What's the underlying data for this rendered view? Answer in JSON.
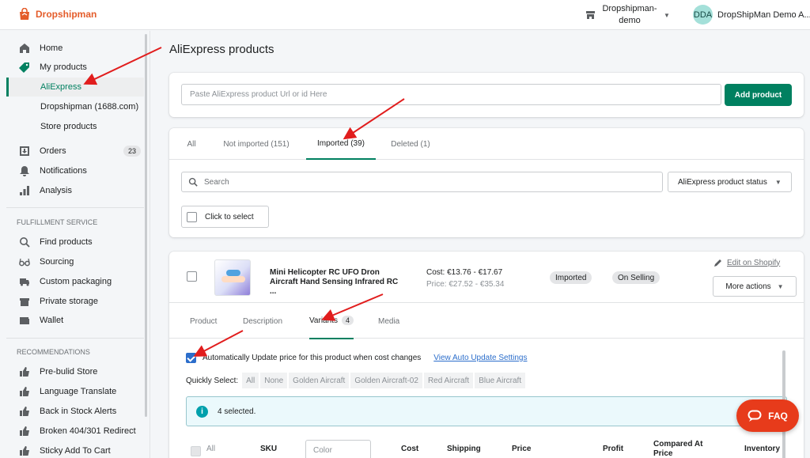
{
  "topbar": {
    "logo_text": "Dropshipman",
    "store_name": "Dropshipman-demo",
    "user_initials": "DDA",
    "user_name": "DropShipMan Demo A..."
  },
  "sidebar": {
    "items": [
      {
        "label": "Home",
        "icon": "home-icon"
      },
      {
        "label": "My products",
        "icon": "tag-icon"
      },
      {
        "label": "AliExpress",
        "active": true
      },
      {
        "label": "Dropshipman (1688.com)"
      },
      {
        "label": "Store products"
      },
      {
        "label": "Orders",
        "icon": "orders-icon",
        "count": "23"
      },
      {
        "label": "Notifications",
        "icon": "bell-icon"
      },
      {
        "label": "Analysis",
        "icon": "chart-icon"
      }
    ],
    "fulfillment_title": "FULFILLMENT SERVICE",
    "fulfillment": [
      {
        "label": "Find products",
        "icon": "search-icon"
      },
      {
        "label": "Sourcing",
        "icon": "glasses-icon"
      },
      {
        "label": "Custom packaging",
        "icon": "truck-icon"
      },
      {
        "label": "Private storage",
        "icon": "box-icon"
      },
      {
        "label": "Wallet",
        "icon": "wallet-icon"
      }
    ],
    "recommendations_title": "RECOMMENDATIONS",
    "recommendations": [
      {
        "label": "Pre-bulid Store",
        "icon": "thumbs-up-icon"
      },
      {
        "label": "Language Translate",
        "icon": "thumbs-up-icon"
      },
      {
        "label": "Back in Stock Alerts",
        "icon": "thumbs-up-icon"
      },
      {
        "label": "Broken 404/301 Redirect",
        "icon": "thumbs-up-icon"
      },
      {
        "label": "Sticky Add To Cart",
        "icon": "thumbs-up-icon"
      }
    ]
  },
  "main": {
    "title": "AliExpress products",
    "url_placeholder": "Paste AliExpress product Url or id Here",
    "add_button": "Add product",
    "tabs": [
      {
        "label": "All"
      },
      {
        "label": "Not imported (151)"
      },
      {
        "label": "Imported (39)",
        "active": true
      },
      {
        "label": "Deleted (1)"
      }
    ],
    "search_placeholder": "Search",
    "status_select": "AliExpress product status",
    "click_to_select": "Click to select"
  },
  "product": {
    "title": "Mini Helicopter RC UFO Dron Aircraft Hand Sensing Infrared RC ...",
    "cost": "Cost: €13.76 - €17.67",
    "price": "Price: €27.52 - €35.34",
    "status_imported": "Imported",
    "status_selling": "On Selling",
    "edit_link": "Edit on Shopify",
    "more_actions": "More actions",
    "sub_tabs": [
      {
        "label": "Product"
      },
      {
        "label": "Description"
      },
      {
        "label": "Variants",
        "badge": "4",
        "active": true
      },
      {
        "label": "Media"
      }
    ],
    "auto_update_label": "Automatically Update price for this product when cost changes",
    "auto_update_checked": true,
    "auto_settings_link": "View Auto Update Settings",
    "quick_select_label": "Quickly Select:",
    "quick_options": [
      "All",
      "None",
      "Golden Aircraft",
      "Golden Aircraft-02",
      "Red Aircraft",
      "Blue Aircraft"
    ],
    "selected_info": "4 selected.",
    "table_headers": {
      "all": "All",
      "sku": "SKU",
      "color_placeholder": "Color",
      "cost": "Cost",
      "shipping": "Shipping",
      "price": "Price",
      "profit": "Profit",
      "compared": "Compared At Price",
      "inventory": "Inventory"
    }
  },
  "faq_label": "FAQ",
  "colors": {
    "brand": "#e45c2a",
    "primary": "#008060",
    "faq": "#e73b1b",
    "arrow": "#e11d1d"
  }
}
